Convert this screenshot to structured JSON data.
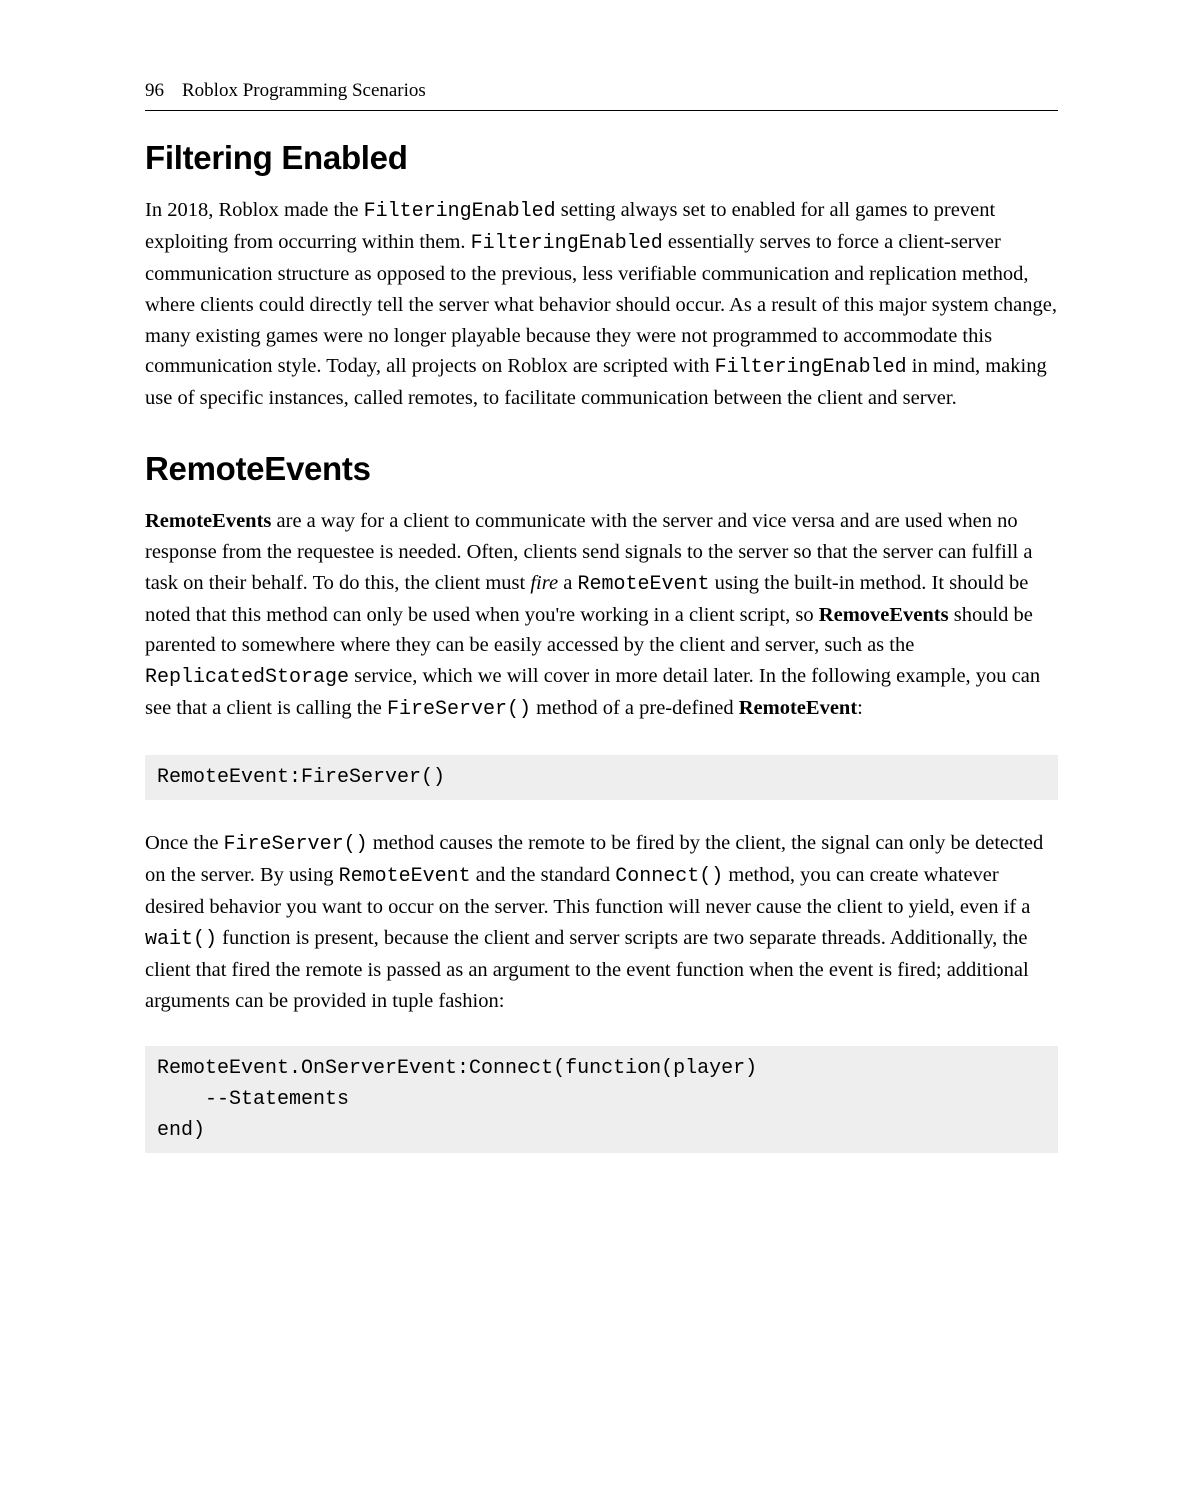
{
  "header": {
    "page_number": "96",
    "running_title": "Roblox Programming Scenarios"
  },
  "section1": {
    "heading": "Filtering Enabled",
    "p1_a": "In 2018, Roblox made the ",
    "p1_code1": "FilteringEnabled",
    "p1_b": " setting always set to enabled for all games to prevent exploiting from occurring within them. ",
    "p1_code2": "FilteringEnabled",
    "p1_c": " essentially serves to force a client-server communication structure as opposed to the previous, less verifiable communication and replication method, where clients could directly tell the server what behavior should occur. As a result of this major system change, many existing games were no longer playable because they were not programmed to accommodate this communication style. Today, all projects on Roblox are scripted with ",
    "p1_code3": "FilteringEnabled",
    "p1_d": " in mind, making use of specific instances, called remotes, to facilitate communication between the client and server."
  },
  "section2": {
    "heading": "RemoteEvents",
    "p1_bold1": "RemoteEvents",
    "p1_a": " are a way for a client to communicate with the server and vice versa and are used when no response from the requestee is needed. Often, clients send signals to the server so that the server can fulfill a task on their behalf. To do this, the client must ",
    "p1_italic1": "fire",
    "p1_b": " a ",
    "p1_code1": "RemoteEvent",
    "p1_c": " using the built-in method. It should be noted that this method can only be used when you're working in a client script, so ",
    "p1_bold2": "RemoveEvents",
    "p1_d": " should be parented to somewhere where they can be easily accessed by the client and server, such as the ",
    "p1_code2": "ReplicatedStorage",
    "p1_e": " service, which we will cover in more detail later. In the following example, you can see that a client is calling the ",
    "p1_code3": "FireServer()",
    "p1_f": " method of a pre-defined ",
    "p1_bold3": "RemoteEvent",
    "p1_g": ":",
    "code1": "RemoteEvent:FireServer()",
    "p2_a": "Once the ",
    "p2_code1": "FireServer()",
    "p2_b": " method causes the remote to be fired by the client, the signal can only be detected on the server. By using ",
    "p2_code2": "RemoteEvent",
    "p2_c": " and the standard ",
    "p2_code3": "Connect()",
    "p2_d": " method, you can create whatever desired behavior you want to occur on the server. This function will never cause the client to yield, even if a ",
    "p2_code4": "wait()",
    "p2_e": " function is present, because the client and server scripts are two separate threads. Additionally, the client that fired the remote is passed as an argument to the event function when the event is fired; additional arguments can be provided in tuple fashion:",
    "code2": "RemoteEvent.OnServerEvent:Connect(function(player)\n    --Statements\nend)"
  }
}
